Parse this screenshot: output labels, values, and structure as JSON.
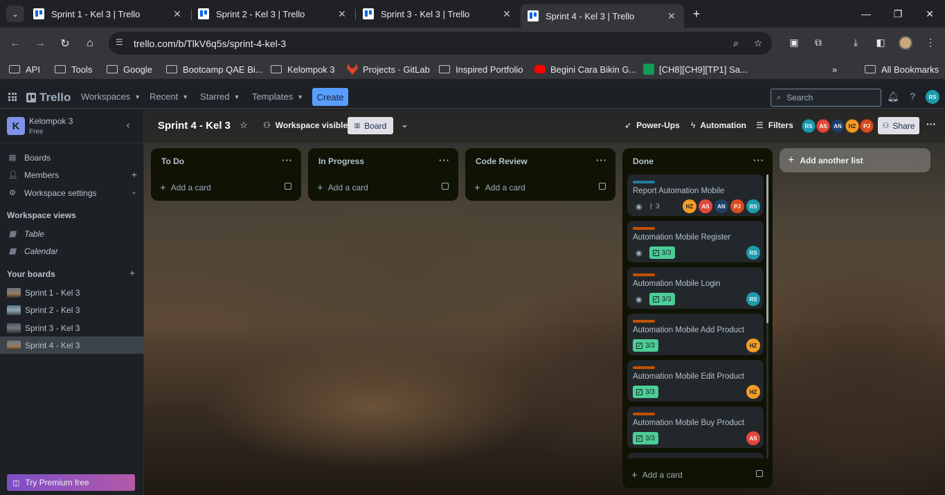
{
  "browser": {
    "tabs": [
      {
        "title": "Sprint 1 - Kel 3 | Trello",
        "active": false
      },
      {
        "title": "Sprint 2 - Kel 3 | Trello",
        "active": false
      },
      {
        "title": "Sprint 3 - Kel 3 | Trello",
        "active": false
      },
      {
        "title": "Sprint 4 - Kel 3 | Trello",
        "active": true
      }
    ],
    "url": "trello.com/b/TlkV6q5s/sprint-4-kel-3",
    "bookmarks": [
      {
        "label": "API",
        "icon": "folder-icon"
      },
      {
        "label": "Tools",
        "icon": "folder-icon"
      },
      {
        "label": "Google",
        "icon": "folder-icon"
      },
      {
        "label": "Bootcamp QAE Bi...",
        "icon": "folder-icon"
      },
      {
        "label": "Kelompok 3",
        "icon": "folder-icon"
      },
      {
        "label": "Projects · GitLab",
        "icon": "gitlab-icon"
      },
      {
        "label": "Inspired Portfolio",
        "icon": "folder-icon"
      },
      {
        "label": "Begini Cara Bikin G...",
        "icon": "youtube-icon"
      },
      {
        "label": "[CH8][CH9][TP1] Sa...",
        "icon": "sheets-icon"
      }
    ],
    "all_bookmarks": "All Bookmarks"
  },
  "header": {
    "logo": "Trello",
    "nav": [
      "Workspaces",
      "Recent",
      "Starred",
      "Templates"
    ],
    "create_label": "Create",
    "search_placeholder": "Search",
    "user_initials": "RS"
  },
  "sidebar": {
    "workspace_initial": "K",
    "workspace_name": "Kelompok 3",
    "workspace_plan": "Free",
    "items": [
      {
        "label": "Boards",
        "icon": "boards-icon"
      },
      {
        "label": "Members",
        "icon": "members-icon"
      },
      {
        "label": "Workspace settings",
        "icon": "gear-icon"
      }
    ],
    "views_title": "Workspace views",
    "views": [
      {
        "label": "Table",
        "icon": "table-icon"
      },
      {
        "label": "Calendar",
        "icon": "calendar-icon"
      }
    ],
    "boards_title": "Your boards",
    "boards": [
      {
        "label": "Sprint 1 - Kel 3",
        "active": false
      },
      {
        "label": "Sprint 2 - Kel 3",
        "active": false
      },
      {
        "label": "Sprint 3 - Kel 3",
        "active": false
      },
      {
        "label": "Sprint 4 - Kel 3",
        "active": true
      }
    ],
    "premium_label": "Try Premium free"
  },
  "board": {
    "title": "Sprint 4 - Kel 3",
    "visibility": "Workspace visible",
    "view": "Board",
    "powerups": "Power-Ups",
    "automation": "Automation",
    "filters": "Filters",
    "members": [
      "RS",
      "AS",
      "AN",
      "HZ",
      "PJ"
    ],
    "share": "Share",
    "add_card_label": "Add a card",
    "add_list_label": "Add another list",
    "lists": [
      {
        "title": "To Do"
      },
      {
        "title": "In Progress"
      },
      {
        "title": "Code Review"
      },
      {
        "title": "Done"
      }
    ],
    "done_cards": [
      {
        "title": "Report Automation Mobile",
        "label_color": "#227d9b",
        "watch": true,
        "attachments": "3",
        "checklist": "",
        "members": [
          "HZ",
          "AS",
          "AN",
          "PJ",
          "RS"
        ]
      },
      {
        "title": "Automation Mobile Register",
        "label_color": "#c25100",
        "watch": true,
        "attachments": "",
        "checklist": "3/3",
        "members": [
          "RS"
        ]
      },
      {
        "title": "Automation Mobile Login",
        "label_color": "#c25100",
        "watch": true,
        "attachments": "",
        "checklist": "3/3",
        "members": [
          "RS"
        ]
      },
      {
        "title": "Automation Mobile Add Product",
        "label_color": "#c25100",
        "watch": false,
        "attachments": "",
        "checklist": "3/3",
        "members": [
          "HZ"
        ]
      },
      {
        "title": "Automation Mobile Edit Product",
        "label_color": "#c25100",
        "watch": false,
        "attachments": "",
        "checklist": "3/3",
        "members": [
          "HZ"
        ]
      },
      {
        "title": "Automation Mobile Buy Product",
        "label_color": "#c25100",
        "watch": false,
        "attachments": "",
        "checklist": "3/3",
        "members": [
          "AS"
        ]
      },
      {
        "title": "",
        "label_color": "#c25100",
        "watch": false,
        "attachments": "",
        "checklist": "",
        "members": []
      }
    ]
  }
}
